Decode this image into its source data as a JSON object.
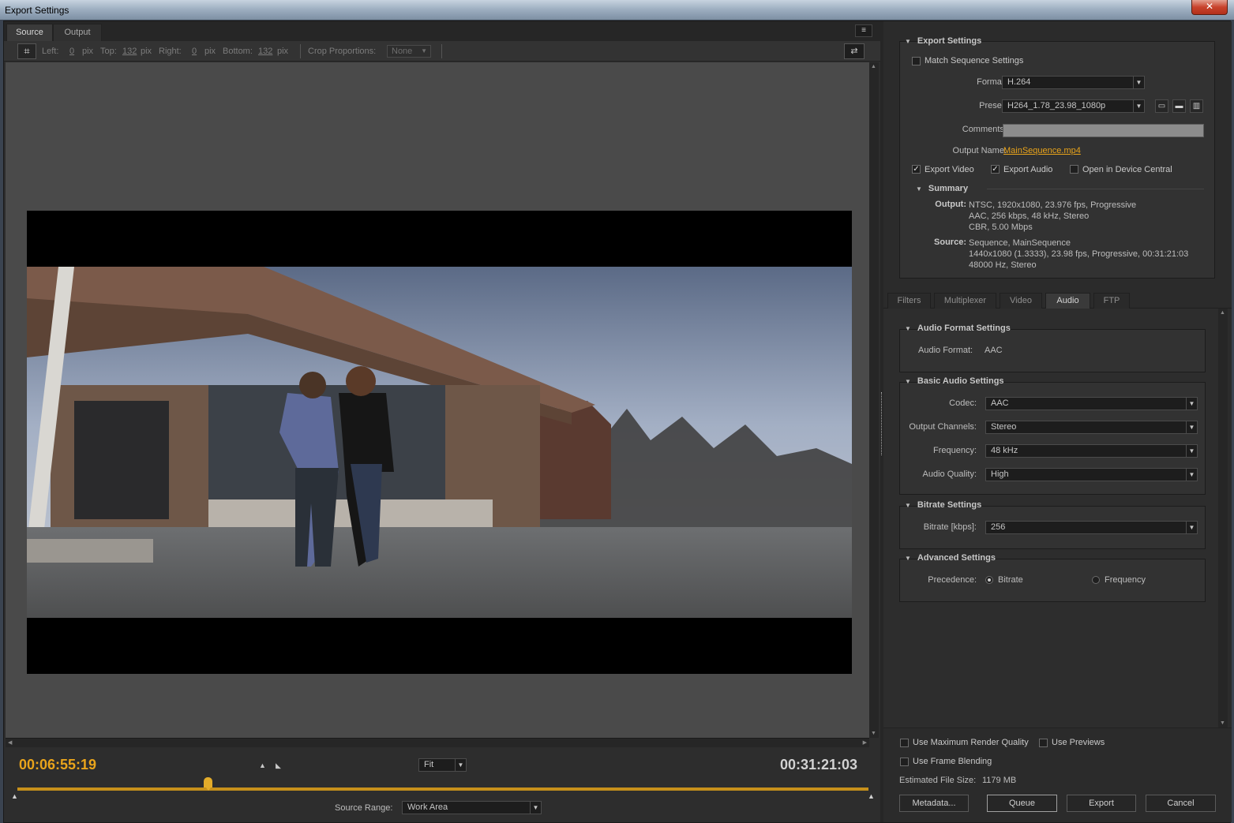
{
  "window": {
    "title": "Export Settings",
    "close_glyph": "✕"
  },
  "source_panel": {
    "tabs": [
      "Source",
      "Output"
    ],
    "menu_icon": "≡",
    "crop": {
      "crop_icon": "⌗",
      "left_label": "Left:",
      "left_value": "0",
      "top_label": "Top:",
      "top_value": "132",
      "right_label": "Right:",
      "right_value": "0",
      "bottom_label": "Bottom:",
      "bottom_value": "132",
      "unit": "pix",
      "proportions_label": "Crop Proportions:",
      "proportions_value": "None",
      "output_icon": "⇄"
    },
    "timecode_current": "00:06:55:19",
    "timecode_duration": "00:31:21:03",
    "mark_in_icon": "▲",
    "mark_out_icon": "◣",
    "zoom_value": "Fit",
    "source_range_label": "Source Range:",
    "source_range_value": "Work Area",
    "playhead_position": 0.224
  },
  "export_settings": {
    "header": "Export Settings",
    "match_sequence_label": "Match Sequence Settings",
    "format_label": "Format:",
    "format_value": "H.264",
    "preset_label": "Preset:",
    "preset_value": "H264_1.78_23.98_1080p",
    "preset_icons": [
      "save-preset-icon",
      "import-preset-icon",
      "delete-preset-icon"
    ],
    "comments_label": "Comments:",
    "comments_value": "",
    "output_name_label": "Output Name:",
    "output_name_value": "MainSequence.mp4",
    "export_video_label": "Export Video",
    "export_video_checked": true,
    "export_audio_label": "Export Audio",
    "export_audio_checked": true,
    "device_central_label": "Open in Device Central",
    "device_central_checked": false,
    "summary": {
      "header": "Summary",
      "output_label": "Output:",
      "output_lines": [
        "NTSC, 1920x1080, 23.976 fps, Progressive",
        "AAC, 256 kbps, 48 kHz, Stereo",
        "CBR, 5.00 Mbps"
      ],
      "source_label": "Source:",
      "source_lines": [
        "Sequence, MainSequence",
        "1440x1080 (1.3333), 23.98 fps, Progressive, 00:31:21:03",
        "48000 Hz, Stereo"
      ]
    }
  },
  "settings_tabs": [
    "Filters",
    "Multiplexer",
    "Video",
    "Audio",
    "FTP"
  ],
  "active_settings_tab": "Audio",
  "audio": {
    "format_group": {
      "header": "Audio Format Settings",
      "format_label": "Audio Format:",
      "format_value": "AAC"
    },
    "basic_group": {
      "header": "Basic Audio Settings",
      "codec_label": "Codec:",
      "codec_value": "AAC",
      "channels_label": "Output Channels:",
      "channels_value": "Stereo",
      "frequency_label": "Frequency:",
      "frequency_value": "48 kHz",
      "quality_label": "Audio Quality:",
      "quality_value": "High"
    },
    "bitrate_group": {
      "header": "Bitrate Settings",
      "bitrate_label": "Bitrate [kbps]:",
      "bitrate_value": "256"
    },
    "advanced_group": {
      "header": "Advanced Settings",
      "precedence_label": "Precedence:",
      "option_bitrate": "Bitrate",
      "option_frequency": "Frequency",
      "selected": "Bitrate"
    }
  },
  "footer": {
    "max_render_quality_label": "Use Maximum Render Quality",
    "use_previews_label": "Use Previews",
    "frame_blending_label": "Use Frame Blending",
    "estimated_size_label": "Estimated File Size:",
    "estimated_size_value": "1179 MB",
    "buttons": {
      "metadata": "Metadata...",
      "queue": "Queue",
      "export": "Export",
      "cancel": "Cancel"
    }
  },
  "glyphs": {
    "dropdown_arrow": "▼",
    "section_triangle": "▼",
    "check": "✓",
    "scroll_up": "▲",
    "scroll_down": "▼",
    "scroll_left": "◀",
    "scroll_right": "▶"
  }
}
